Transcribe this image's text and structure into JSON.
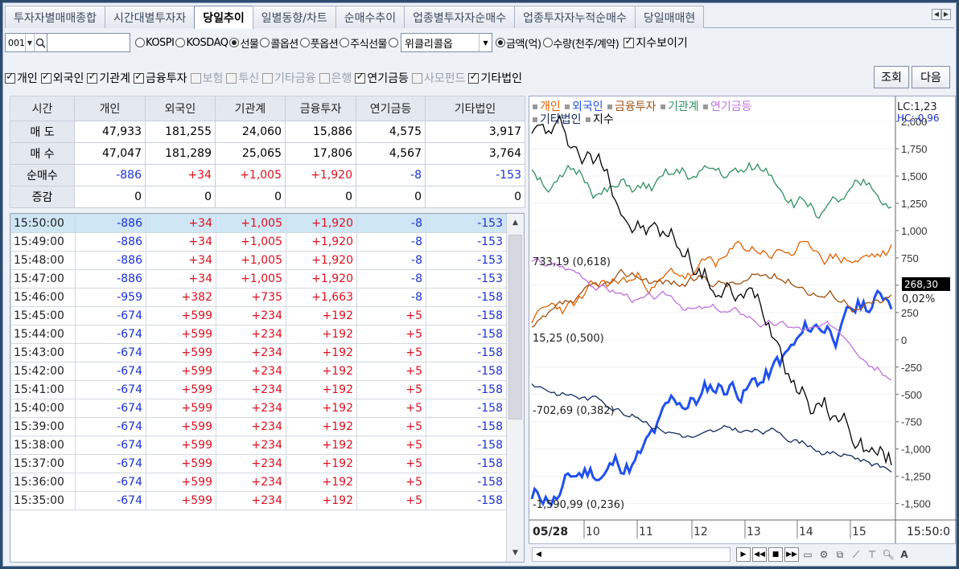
{
  "tabs": [
    "투자자별매매종합",
    "시간대별투자자",
    "당일추이",
    "일별동향/차트",
    "순매수추이",
    "업종별투자자순매수",
    "업종투자자누적순매수",
    "당일매매현"
  ],
  "active_tab": 2,
  "toolbar": {
    "code": "001",
    "markets": [
      "KOSPI",
      "KOSDAQ",
      "선물",
      "콜옵션",
      "풋옵션",
      "주식선물",
      ""
    ],
    "market_selected": 2,
    "weekly_label": "위클리콜옵",
    "units": [
      "금액(억)",
      "수량(천주/계약)"
    ],
    "unit_selected": 0,
    "show_index_label": "지수보이기",
    "investor_filters": [
      {
        "label": "개인",
        "checked": true,
        "enabled": true
      },
      {
        "label": "외국인",
        "checked": true,
        "enabled": true
      },
      {
        "label": "기관계",
        "checked": true,
        "enabled": true
      },
      {
        "label": "금융투자",
        "checked": true,
        "enabled": true
      },
      {
        "label": "보험",
        "checked": false,
        "enabled": false
      },
      {
        "label": "투신",
        "checked": false,
        "enabled": false
      },
      {
        "label": "기타금융",
        "checked": false,
        "enabled": false
      },
      {
        "label": "은행",
        "checked": false,
        "enabled": false
      },
      {
        "label": "연기금등",
        "checked": true,
        "enabled": true
      },
      {
        "label": "사모펀드",
        "checked": false,
        "enabled": false
      },
      {
        "label": "기타법인",
        "checked": true,
        "enabled": true
      }
    ],
    "query_button": "조회",
    "next_button": "다음"
  },
  "summary": {
    "headers": [
      "시간",
      "개인",
      "외국인",
      "기관계",
      "금융투자",
      "연기금등",
      "기타법인"
    ],
    "rows": [
      {
        "label": "매 도",
        "values": [
          "47,933",
          "181,255",
          "24,060",
          "15,886",
          "4,575",
          "3,917"
        ],
        "colors": [
          "k",
          "k",
          "k",
          "k",
          "k",
          "k"
        ]
      },
      {
        "label": "매 수",
        "values": [
          "47,047",
          "181,289",
          "25,065",
          "17,806",
          "4,567",
          "3,764"
        ],
        "colors": [
          "k",
          "k",
          "k",
          "k",
          "k",
          "k"
        ]
      },
      {
        "label": "순매수",
        "values": [
          "-886",
          "+34",
          "+1,005",
          "+1,920",
          "-8",
          "-153"
        ],
        "colors": [
          "b",
          "r",
          "r",
          "r",
          "b",
          "b"
        ]
      },
      {
        "label": "증감",
        "values": [
          "0",
          "0",
          "0",
          "0",
          "0",
          "0"
        ],
        "colors": [
          "k",
          "k",
          "k",
          "k",
          "k",
          "k"
        ]
      }
    ]
  },
  "time_rows": [
    {
      "time": "15:50:00",
      "values": [
        "-886",
        "+34",
        "+1,005",
        "+1,920",
        "-8",
        "-153"
      ]
    },
    {
      "time": "15:49:00",
      "values": [
        "-886",
        "+34",
        "+1,005",
        "+1,920",
        "-8",
        "-153"
      ]
    },
    {
      "time": "15:48:00",
      "values": [
        "-886",
        "+34",
        "+1,005",
        "+1,920",
        "-8",
        "-153"
      ]
    },
    {
      "time": "15:47:00",
      "values": [
        "-886",
        "+34",
        "+1,005",
        "+1,920",
        "-8",
        "-153"
      ]
    },
    {
      "time": "15:46:00",
      "values": [
        "-959",
        "+382",
        "+735",
        "+1,663",
        "-8",
        "-158"
      ]
    },
    {
      "time": "15:45:00",
      "values": [
        "-674",
        "+599",
        "+234",
        "+192",
        "+5",
        "-158"
      ]
    },
    {
      "time": "15:44:00",
      "values": [
        "-674",
        "+599",
        "+234",
        "+192",
        "+5",
        "-158"
      ]
    },
    {
      "time": "15:43:00",
      "values": [
        "-674",
        "+599",
        "+234",
        "+192",
        "+5",
        "-158"
      ]
    },
    {
      "time": "15:42:00",
      "values": [
        "-674",
        "+599",
        "+234",
        "+192",
        "+5",
        "-158"
      ]
    },
    {
      "time": "15:41:00",
      "values": [
        "-674",
        "+599",
        "+234",
        "+192",
        "+5",
        "-158"
      ]
    },
    {
      "time": "15:40:00",
      "values": [
        "-674",
        "+599",
        "+234",
        "+192",
        "+5",
        "-158"
      ]
    },
    {
      "time": "15:39:00",
      "values": [
        "-674",
        "+599",
        "+234",
        "+192",
        "+5",
        "-158"
      ]
    },
    {
      "time": "15:38:00",
      "values": [
        "-674",
        "+599",
        "+234",
        "+192",
        "+5",
        "-158"
      ]
    },
    {
      "time": "15:37:00",
      "values": [
        "-674",
        "+599",
        "+234",
        "+192",
        "+5",
        "-158"
      ]
    },
    {
      "time": "15:36:00",
      "values": [
        "-674",
        "+599",
        "+234",
        "+192",
        "+5",
        "-158"
      ]
    },
    {
      "time": "15:35:00",
      "values": [
        "-674",
        "+599",
        "+234",
        "+192",
        "+5",
        "-158"
      ]
    }
  ],
  "colors": {
    "positive": "#e0101f",
    "negative": "#1a30d8",
    "selected_row": "#cfe6f5"
  },
  "chart_data": {
    "type": "line",
    "legend": [
      {
        "name": "개인",
        "color": "#e06000"
      },
      {
        "name": "외국인",
        "color": "#2050f0"
      },
      {
        "name": "금융투자",
        "color": "#a05010"
      },
      {
        "name": "기관계",
        "color": "#309060"
      },
      {
        "name": "연기금등",
        "color": "#c070e0"
      },
      {
        "name": "기타법인",
        "color": "#102a60"
      },
      {
        "name": "지수",
        "color": "#000000"
      }
    ],
    "corner_labels": [
      "LC:1,23",
      "HC:-0,96"
    ],
    "y_ticks": [
      "2,000",
      "1,750",
      "1,500",
      "1,250",
      "1,000",
      "750",
      "500",
      "250",
      "0",
      "-250",
      "-500",
      "-750",
      "-1,000",
      "-1,250",
      "-1,500"
    ],
    "ylim": [
      -1650,
      2170
    ],
    "annotations": [
      "733,19 (0,618)",
      "15,25 (0,500)",
      "-702,69 (0,382)",
      "-1,590,99 (0,236)"
    ],
    "current_value": "268,30",
    "current_pct": "0,02%",
    "x_date": "05/28",
    "x_ticks": [
      "10",
      "11",
      "12",
      "13",
      "14",
      "15"
    ],
    "x_time": "15:50:0"
  }
}
